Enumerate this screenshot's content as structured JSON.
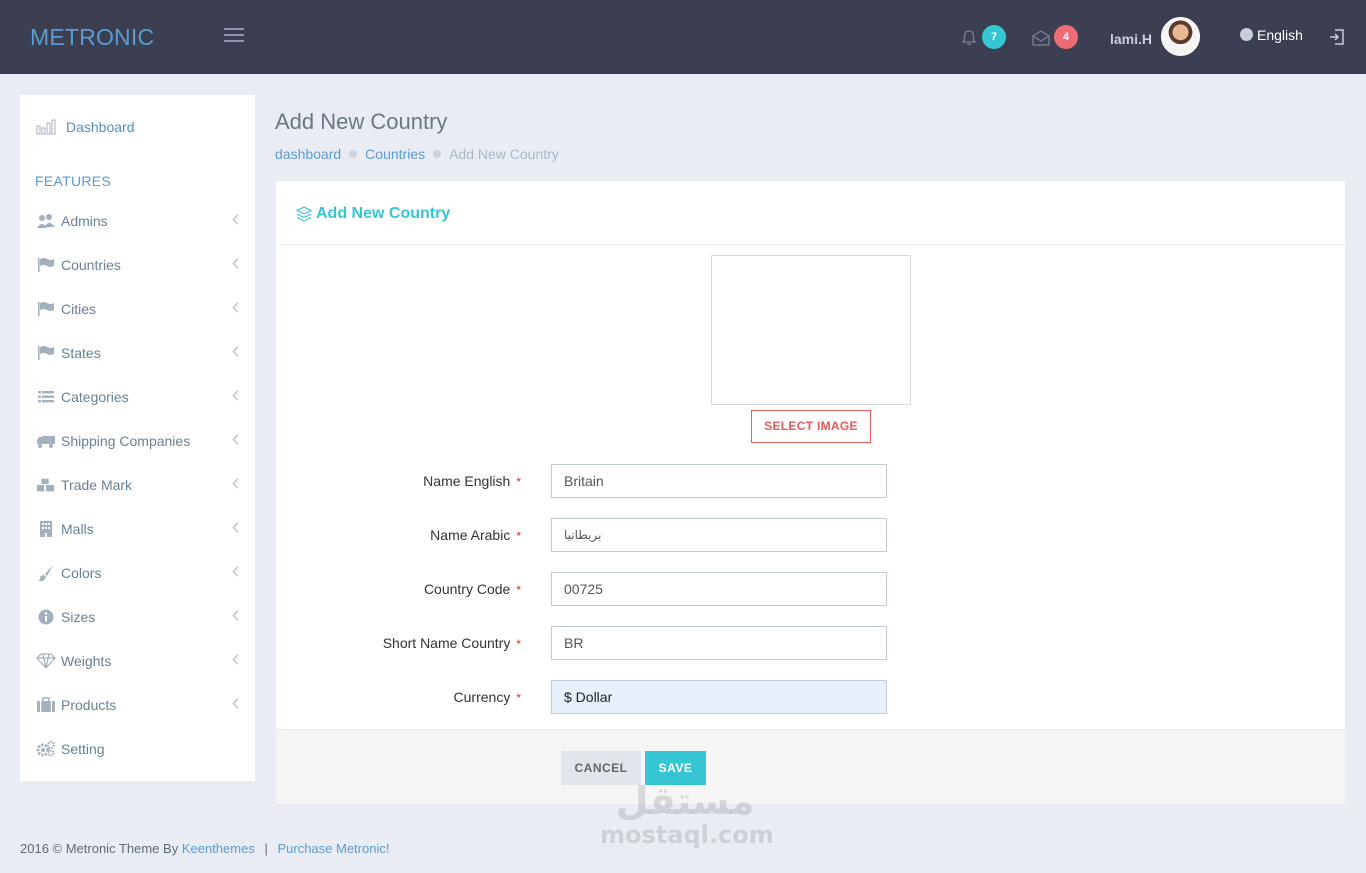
{
  "header": {
    "logo": "METRONIC",
    "notifications_count": "7",
    "messages_count": "4",
    "username": "lami.H",
    "language": "English"
  },
  "sidebar": {
    "dashboard": "Dashboard",
    "heading": "FEATURES",
    "items": [
      {
        "label": "Admins",
        "icon": "users-icon"
      },
      {
        "label": "Countries",
        "icon": "flag-icon"
      },
      {
        "label": "Cities",
        "icon": "flag-icon"
      },
      {
        "label": "States",
        "icon": "flag-icon"
      },
      {
        "label": "Categories",
        "icon": "list-icon"
      },
      {
        "label": "Shipping Companies",
        "icon": "truck-icon"
      },
      {
        "label": "Trade Mark",
        "icon": "cubes-icon"
      },
      {
        "label": "Malls",
        "icon": "building-icon"
      },
      {
        "label": "Colors",
        "icon": "paint-brush-icon"
      },
      {
        "label": "Sizes",
        "icon": "info-icon"
      },
      {
        "label": "Weights",
        "icon": "diamond-icon"
      },
      {
        "label": "Products",
        "icon": "briefcase-icon"
      },
      {
        "label": "Setting",
        "icon": "cogs-icon"
      }
    ]
  },
  "page": {
    "title": "Add New Country",
    "breadcrumb": [
      "dashboard",
      "Countries",
      "Add New Country"
    ]
  },
  "form": {
    "title": "Add New Country",
    "select_image": "SELECT IMAGE",
    "required_mark": "*",
    "fields": [
      {
        "label": "Name English",
        "value": "Britain"
      },
      {
        "label": "Name Arabic",
        "value": "بريطانيا"
      },
      {
        "label": "Country Code",
        "value": "00725"
      },
      {
        "label": "Short Name Country",
        "value": "BR"
      },
      {
        "label": "Currency",
        "value": "$ Dollar"
      }
    ],
    "cancel": "CANCEL",
    "save": "SAVE"
  },
  "watermark": {
    "arabic": "مستقل",
    "latin": "mostaql.com"
  },
  "footer": {
    "copyright": "2016 © Metronic Theme By",
    "author_link": "Keenthemes",
    "separator": "|",
    "purchase_link": "Purchase Metronic!"
  },
  "colors": {
    "accent": "#36c6d3",
    "danger": "#e35b5a",
    "header_bg": "#3b3f51",
    "logo": "#5b9bd1"
  }
}
